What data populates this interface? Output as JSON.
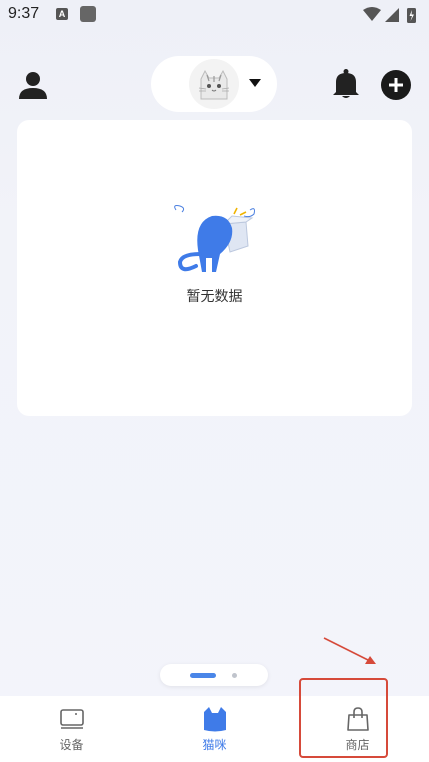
{
  "status_bar": {
    "time": "9:37",
    "notif_letter": "A"
  },
  "empty_state": {
    "text": "暂无数据"
  },
  "tabs": [
    {
      "label": "设备",
      "icon": "device-icon",
      "active": false
    },
    {
      "label": "猫咪",
      "icon": "cat-icon",
      "active": true
    },
    {
      "label": "商店",
      "icon": "shopping-bag-icon",
      "active": false
    }
  ],
  "colors": {
    "accent": "#3f7be8",
    "highlight": "#d64a3a"
  }
}
